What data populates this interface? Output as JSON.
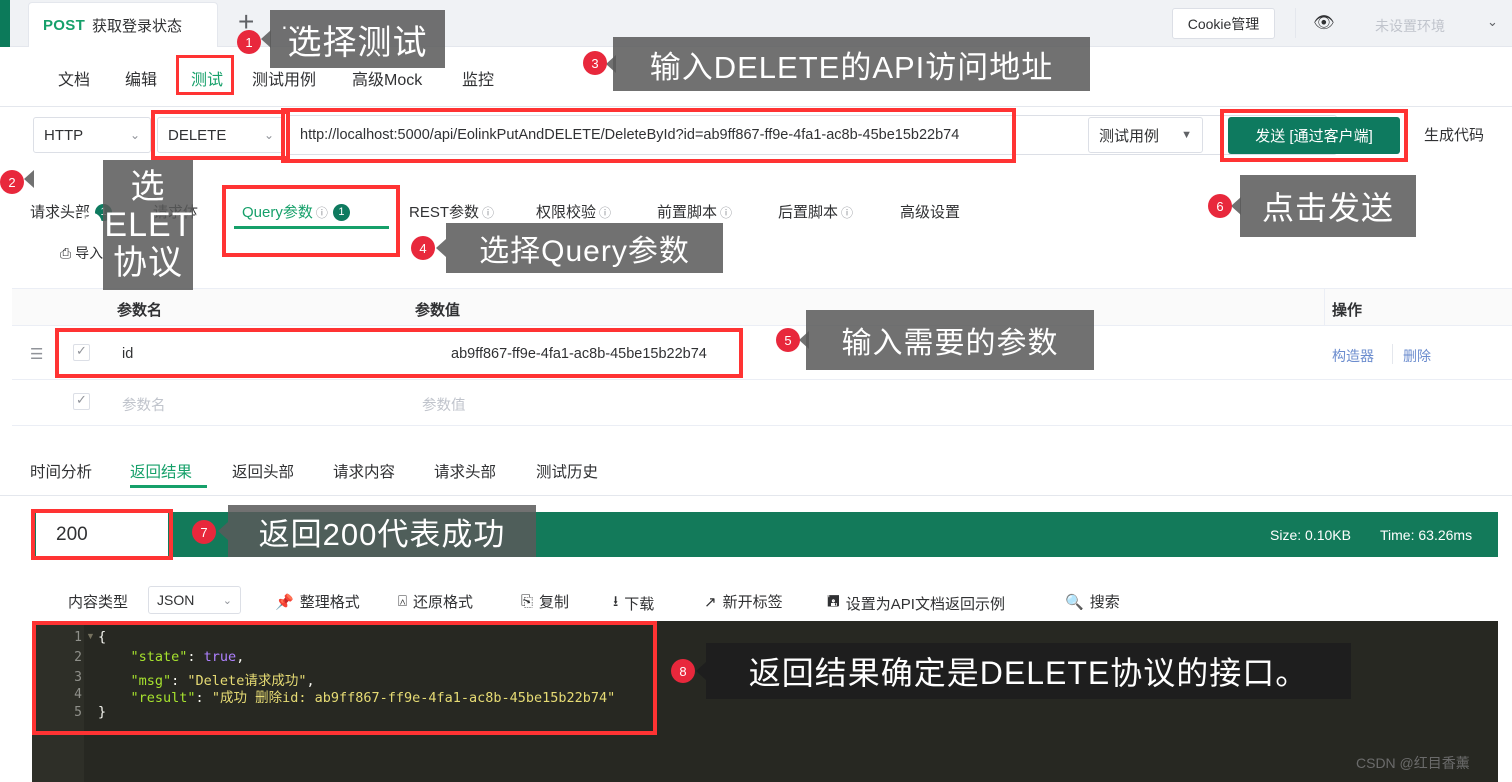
{
  "window": {
    "doc_tab": {
      "method": "POST",
      "title": "获取登录状态"
    },
    "add_tab": "+",
    "cookie_button": "Cookie管理",
    "eye_icon": "eye-icon",
    "environment": "未设置环境",
    "env_caret": "⌄"
  },
  "subtabs": [
    {
      "label": "文档",
      "active": false
    },
    {
      "label": "编辑",
      "active": false
    },
    {
      "label": "测试",
      "active": true
    },
    {
      "label": "测试用例",
      "active": false
    },
    {
      "label": "高级Mock",
      "active": false
    },
    {
      "label": "监控",
      "active": false
    }
  ],
  "url_row": {
    "protocol": "HTTP",
    "method": "DELETE",
    "url": "http://localhost:5000/api/EolinkPutAndDELETE/DeleteById?id=ab9ff867-ff9e-4fa1-ac8b-45be15b22b74",
    "test_case": "测试用例",
    "send_button": "发送 [通过客户端]",
    "generate_code": "生成代码",
    "caret": "⌄"
  },
  "request_tabs": [
    {
      "label": "请求头部",
      "badge": "1",
      "info": false,
      "active": false
    },
    {
      "label": "请求体",
      "badge": "",
      "info": false,
      "active": false
    },
    {
      "label": "Query参数",
      "badge": "1",
      "info": true,
      "active": true
    },
    {
      "label": "REST参数",
      "badge": "",
      "info": true,
      "active": false
    },
    {
      "label": "权限校验",
      "badge": "",
      "info": true,
      "active": false
    },
    {
      "label": "前置脚本",
      "badge": "",
      "info": true,
      "active": false
    },
    {
      "label": "后置脚本",
      "badge": "",
      "info": true,
      "active": false
    },
    {
      "label": "高级设置",
      "badge": "",
      "info": false,
      "active": false
    }
  ],
  "import_label": "导入",
  "param_table": {
    "headers": [
      "参数名",
      "参数值",
      "操作"
    ],
    "rows": [
      {
        "checked": true,
        "name": "id",
        "value": "ab9ff867-ff9e-4fa1-ac8b-45be15b22b74",
        "actions": [
          "构造器",
          "删除"
        ]
      },
      {
        "checked": true,
        "name_placeholder": "参数名",
        "value_placeholder": "参数值",
        "actions": []
      }
    ]
  },
  "response_tabs": [
    {
      "label": "时间分析",
      "active": false
    },
    {
      "label": "返回结果",
      "active": true
    },
    {
      "label": "返回头部",
      "active": false
    },
    {
      "label": "请求内容",
      "active": false
    },
    {
      "label": "请求头部",
      "active": false
    },
    {
      "label": "测试历史",
      "active": false
    }
  ],
  "status_bar": {
    "code": "200",
    "size": "Size: 0.10KB",
    "time": "Time: 63.26ms",
    "bg_color": "#137a5a"
  },
  "code_toolbar": {
    "content_type_label": "内容类型",
    "content_type_value": "JSON",
    "caret": "⌄",
    "items": [
      {
        "icon": "pin-icon",
        "glyph": "📌",
        "label": "整理格式"
      },
      {
        "icon": "restore-icon",
        "glyph": "⎔",
        "label": "还原格式"
      },
      {
        "icon": "copy-icon",
        "glyph": "⎘",
        "label": "复制"
      },
      {
        "icon": "download-icon",
        "glyph": "⭳",
        "label": "下载"
      },
      {
        "icon": "new-tab-icon",
        "glyph": "↗",
        "label": "新开标签"
      },
      {
        "icon": "save-icon",
        "glyph": "🖫",
        "label": "设置为API文档返回示例"
      },
      {
        "icon": "search-icon",
        "glyph": "🔍",
        "label": "搜索"
      }
    ]
  },
  "code_block": {
    "lines": [
      {
        "num": "1",
        "parts": [
          {
            "t": "{",
            "c": "punc"
          }
        ]
      },
      {
        "num": "2",
        "parts": [
          {
            "t": "    \"state\"",
            "c": "key"
          },
          {
            "t": ": ",
            "c": "punc"
          },
          {
            "t": "true",
            "c": "bool"
          },
          {
            "t": ",",
            "c": "punc"
          }
        ]
      },
      {
        "num": "3",
        "parts": [
          {
            "t": "    \"msg\"",
            "c": "key"
          },
          {
            "t": ": ",
            "c": "punc"
          },
          {
            "t": "\"Delete请求成功\"",
            "c": "str"
          },
          {
            "t": ",",
            "c": "punc"
          }
        ]
      },
      {
        "num": "4",
        "parts": [
          {
            "t": "    \"result\"",
            "c": "key"
          },
          {
            "t": ": ",
            "c": "punc"
          },
          {
            "t": "\"成功 删除id: ab9ff867-ff9e-4fa1-ac8b-45be15b22b74\"",
            "c": "str"
          }
        ]
      },
      {
        "num": "5",
        "parts": [
          {
            "t": "}",
            "c": "punc"
          }
        ]
      }
    ]
  },
  "callouts": [
    {
      "num": "1",
      "text": "选择测试"
    },
    {
      "num": "2",
      "text": "选\nDELETE\n协议"
    },
    {
      "num": "3",
      "text": "输入DELETE的API访问地址"
    },
    {
      "num": "4",
      "text": "选择Query参数"
    },
    {
      "num": "5",
      "text": "输入需要的参数"
    },
    {
      "num": "6",
      "text": "点击发送"
    },
    {
      "num": "7",
      "text": "返回200代表成功"
    },
    {
      "num": "8",
      "text": "返回结果确定是DELETE协议的接口。"
    }
  ],
  "watermark": "CSDN @红目香薰",
  "colors": {
    "accent_green": "#16a06a",
    "send_green": "#0e7a5f",
    "status_green": "#137a5a",
    "highlight_red": "#ff3333",
    "badge_red": "#e8283c"
  }
}
